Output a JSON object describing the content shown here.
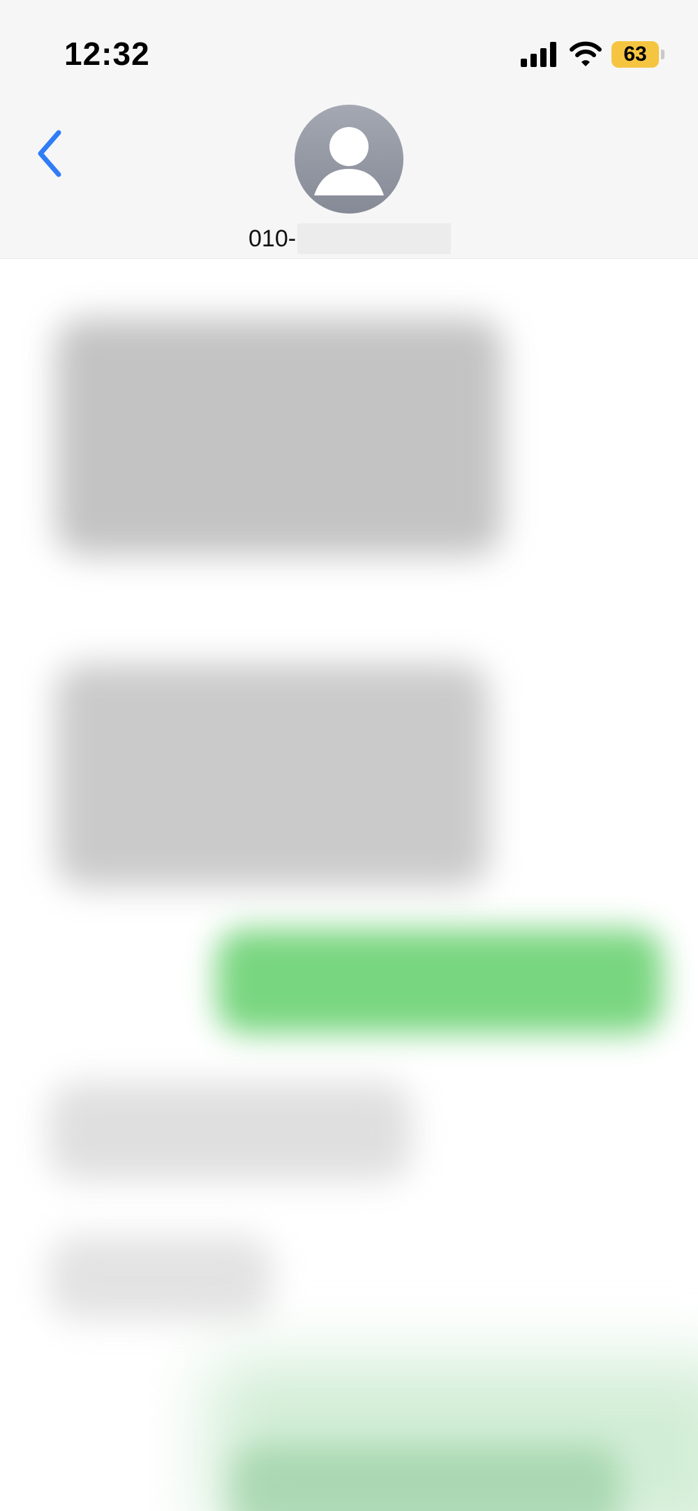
{
  "status_bar": {
    "time": "12:32",
    "battery_level": "63",
    "icons": [
      "signal-icon",
      "wifi-icon",
      "battery-icon"
    ],
    "battery_color": "#f5c542"
  },
  "header": {
    "back_icon": "chevron-left-icon",
    "avatar_icon": "person-icon",
    "contact_prefix": "010-",
    "accent_color": "#2f7cf6"
  },
  "messages": {
    "note": "",
    "items": [
      {
        "direction": "received",
        "content": ""
      },
      {
        "direction": "received",
        "content": ""
      },
      {
        "direction": "sent",
        "content": ""
      },
      {
        "direction": "received",
        "content": ""
      },
      {
        "direction": "received",
        "content": ""
      },
      {
        "direction": "sent",
        "content": ""
      }
    ],
    "sent_color": "#62cf6a",
    "received_color": "#b9b9b9"
  }
}
